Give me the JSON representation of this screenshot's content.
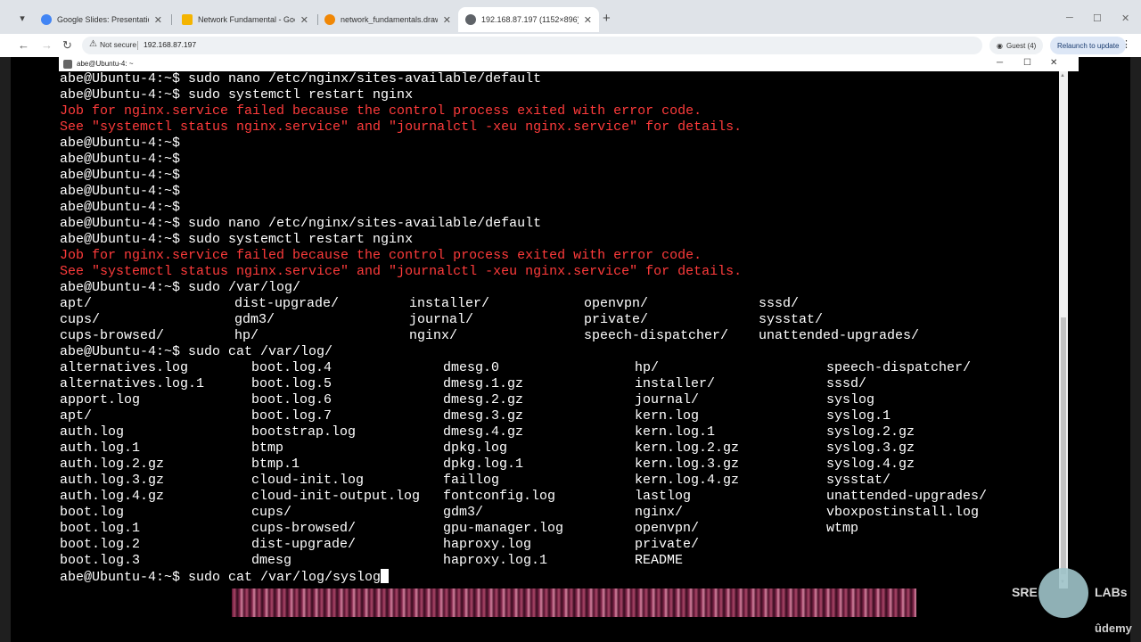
{
  "browser": {
    "tabs": [
      {
        "title": "Google Slides: Presentation Slides",
        "icon": "google-icon",
        "color": "#4285f4"
      },
      {
        "title": "Network Fundamental - Google Slides",
        "icon": "slides-icon",
        "color": "#f4b400"
      },
      {
        "title": "network_fundamentals.drawio",
        "icon": "drawio-icon",
        "color": "#f08705"
      },
      {
        "title": "192.168.87.197 (1152×896)",
        "icon": "globe-icon",
        "color": "#5f6368"
      }
    ],
    "new_tab": "+",
    "security_label": "Not secure",
    "url": "192.168.87.197",
    "profile_label": "Guest (4)",
    "relaunch_label": "Relaunch to update"
  },
  "window": {
    "title": "abe@Ubuntu-4: ~"
  },
  "terminal": {
    "lines": [
      {
        "text": "abe@Ubuntu-4:~$ sudo nano /etc/nginx/sites-available/default",
        "type": "normal"
      },
      {
        "text": "abe@Ubuntu-4:~$ sudo systemctl restart nginx",
        "type": "normal"
      },
      {
        "text": "Job for nginx.service failed because the control process exited with error code.",
        "type": "err"
      },
      {
        "text": "See \"systemctl status nginx.service\" and \"journalctl -xeu nginx.service\" for details.",
        "type": "err"
      },
      {
        "text": "abe@Ubuntu-4:~$",
        "type": "normal"
      },
      {
        "text": "abe@Ubuntu-4:~$",
        "type": "normal"
      },
      {
        "text": "abe@Ubuntu-4:~$",
        "type": "normal"
      },
      {
        "text": "abe@Ubuntu-4:~$",
        "type": "normal"
      },
      {
        "text": "abe@Ubuntu-4:~$",
        "type": "normal"
      },
      {
        "text": "abe@Ubuntu-4:~$ sudo nano /etc/nginx/sites-available/default",
        "type": "normal"
      },
      {
        "text": "abe@Ubuntu-4:~$ sudo systemctl restart nginx",
        "type": "normal"
      },
      {
        "text": "Job for nginx.service failed because the control process exited with error code.",
        "type": "err"
      },
      {
        "text": "See \"systemctl status nginx.service\" and \"journalctl -xeu nginx.service\" for details.",
        "type": "err"
      },
      {
        "text": "abe@Ubuntu-4:~$ sudo /var/log/",
        "type": "normal"
      }
    ],
    "completion1": [
      [
        "apt/",
        "dist-upgrade/",
        "installer/",
        "openvpn/",
        "sssd/"
      ],
      [
        "cups/",
        "gdm3/",
        "journal/",
        "private/",
        "sysstat/"
      ],
      [
        "cups-browsed/",
        "hp/",
        "nginx/",
        "speech-dispatcher/",
        "unattended-upgrades/"
      ]
    ],
    "cat_prompt": "abe@Ubuntu-4:~$ sudo cat /var/log/",
    "completion2": [
      [
        "alternatives.log",
        "boot.log.4",
        "dmesg.0",
        "hp/",
        "speech-dispatcher/"
      ],
      [
        "alternatives.log.1",
        "boot.log.5",
        "dmesg.1.gz",
        "installer/",
        "sssd/"
      ],
      [
        "apport.log",
        "boot.log.6",
        "dmesg.2.gz",
        "journal/",
        "syslog"
      ],
      [
        "apt/",
        "boot.log.7",
        "dmesg.3.gz",
        "kern.log",
        "syslog.1"
      ],
      [
        "auth.log",
        "bootstrap.log",
        "dmesg.4.gz",
        "kern.log.1",
        "syslog.2.gz"
      ],
      [
        "auth.log.1",
        "btmp",
        "dpkg.log",
        "kern.log.2.gz",
        "syslog.3.gz"
      ],
      [
        "auth.log.2.gz",
        "btmp.1",
        "dpkg.log.1",
        "kern.log.3.gz",
        "syslog.4.gz"
      ],
      [
        "auth.log.3.gz",
        "cloud-init.log",
        "faillog",
        "kern.log.4.gz",
        "sysstat/"
      ],
      [
        "auth.log.4.gz",
        "cloud-init-output.log",
        "fontconfig.log",
        "lastlog",
        "unattended-upgrades/"
      ],
      [
        "boot.log",
        "cups/",
        "gdm3/",
        "nginx/",
        "vboxpostinstall.log"
      ],
      [
        "boot.log.1",
        "cups-browsed/",
        "gpu-manager.log",
        "openvpn/",
        "wtmp"
      ],
      [
        "boot.log.2",
        "dist-upgrade/",
        "haproxy.log",
        "private/",
        ""
      ],
      [
        "boot.log.3",
        "dmesg",
        "haproxy.log.1",
        "README",
        ""
      ]
    ],
    "current_input": "abe@Ubuntu-4:~$ sudo cat /var/log/syslog",
    "error_color": "#ff3b3b"
  },
  "overlay": {
    "brand_left": "SRE",
    "brand_right": "LABs",
    "platform": "ûdemy"
  }
}
